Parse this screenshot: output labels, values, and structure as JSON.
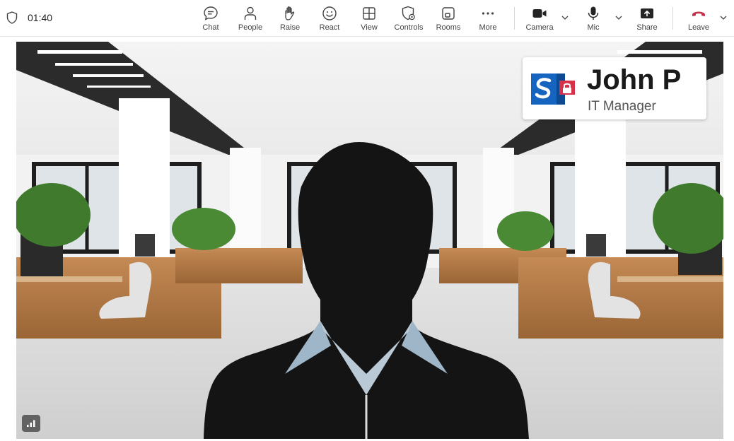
{
  "meeting": {
    "elapsed": "01:40"
  },
  "toolbar": {
    "chat": "Chat",
    "people": "People",
    "raise": "Raise",
    "react": "React",
    "view": "View",
    "controls": "Controls",
    "rooms": "Rooms",
    "more": "More",
    "camera": "Camera",
    "mic": "Mic",
    "share": "Share",
    "leave": "Leave"
  },
  "nameplate": {
    "name": "John P",
    "title": "IT Manager"
  },
  "colors": {
    "leave": "#c4314b",
    "brand_blue": "#1565c0",
    "lock_red": "#d9304a"
  },
  "icons": [
    "shield-icon",
    "chat-icon",
    "people-icon",
    "raise-hand-icon",
    "react-icon",
    "view-icon",
    "controls-icon",
    "rooms-icon",
    "more-icon",
    "camera-icon",
    "mic-icon",
    "share-icon",
    "leave-icon",
    "chevron-down-icon",
    "signal-icon"
  ]
}
